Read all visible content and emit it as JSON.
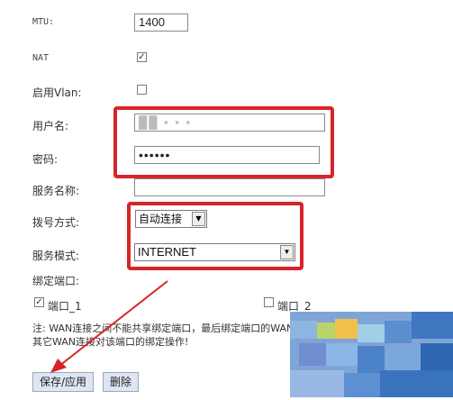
{
  "form": {
    "mtu": {
      "label": "MTU:",
      "value": "1400"
    },
    "nat": {
      "label": "NAT",
      "checked": true
    },
    "vlan": {
      "label": "启用Vlan:",
      "checked": false
    },
    "username": {
      "label": "用户名:",
      "value": "██ ▪ ▪ ▪"
    },
    "password": {
      "label": "密码:",
      "value": "••••••"
    },
    "service_name": {
      "label": "服务名称:",
      "value": ""
    },
    "dial_mode": {
      "label": "拨号方式:",
      "value": "自动连接"
    },
    "service_mode": {
      "label": "服务模式:",
      "value": "INTERNET"
    },
    "bind_port": {
      "label": "绑定端口:"
    },
    "ports": [
      {
        "label": "端口_1",
        "checked": true
      },
      {
        "label": "端口_2",
        "checked": false
      }
    ],
    "note_line1": "注: WAN连接之间不能共享绑定端口，最后绑定端口的WAN连接(绑定操作)将会生效",
    "note_line2": "其它WAN连接对该端口的绑定操作!"
  },
  "buttons": {
    "save": "保存/应用",
    "delete": "删除"
  },
  "colors": {
    "highlight": "#d8232a",
    "button_bg": "#dde6f2"
  }
}
